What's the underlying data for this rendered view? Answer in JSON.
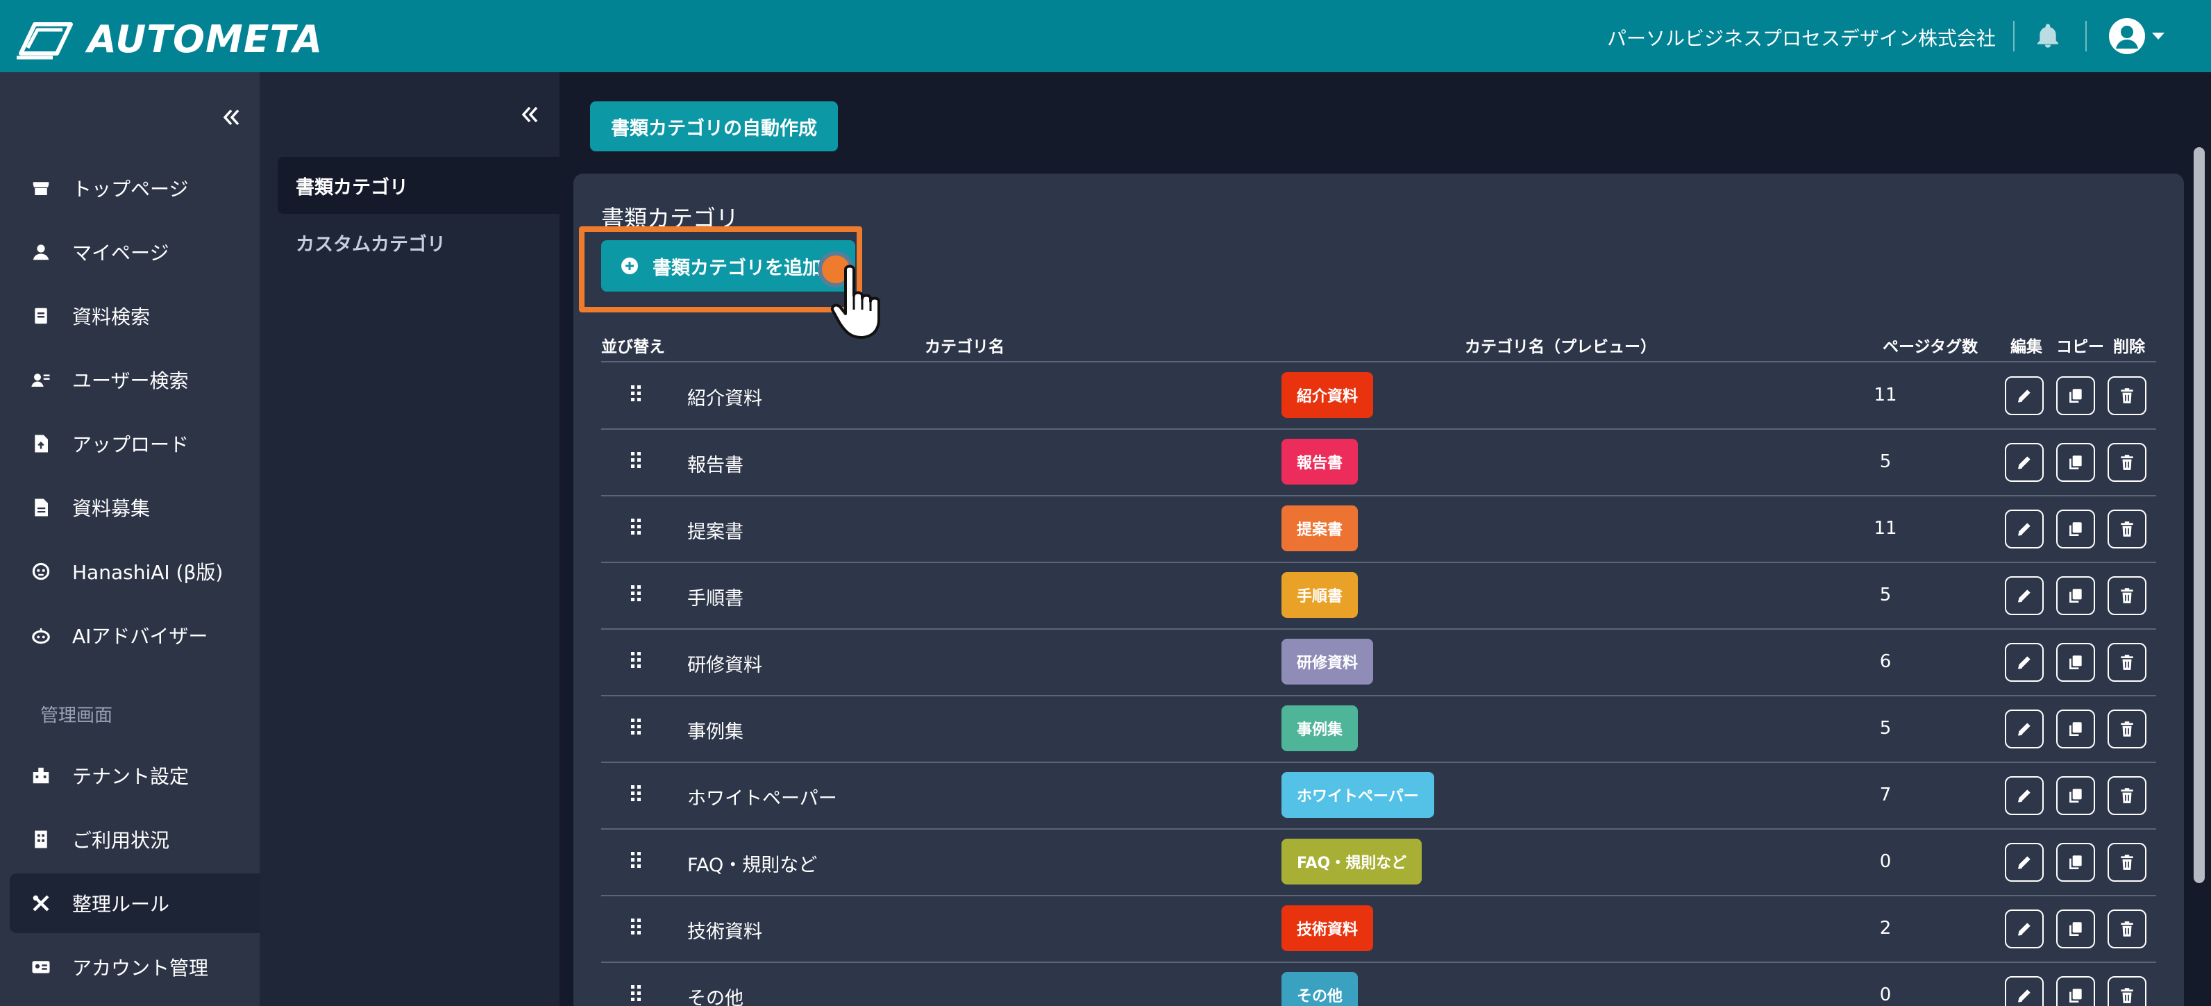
{
  "header": {
    "logo_text": "AUTOMETA",
    "company": "パーソルビジネスプロセスデザイン株式会社",
    "bg_color": "#028394"
  },
  "sidebar": {
    "items": [
      {
        "label": "トップページ",
        "icon": "store-icon"
      },
      {
        "label": "マイページ",
        "icon": "person-icon"
      },
      {
        "label": "資料検索",
        "icon": "document-search-icon"
      },
      {
        "label": "ユーザー検索",
        "icon": "user-search-icon"
      },
      {
        "label": "アップロード",
        "icon": "upload-file-icon"
      },
      {
        "label": "資料募集",
        "icon": "file-icon"
      },
      {
        "label": "HanashiAI (β版)",
        "icon": "chat-bot-icon"
      },
      {
        "label": "AIアドバイザー",
        "icon": "robot-icon"
      }
    ],
    "section_label": "管理画面",
    "admin_items": [
      {
        "label": "テナント設定",
        "icon": "building-settings-icon"
      },
      {
        "label": "ご利用状況",
        "icon": "office-building-icon"
      },
      {
        "label": "整理ルール",
        "icon": "tools-icon",
        "active": true
      },
      {
        "label": "アカウント管理",
        "icon": "id-card-icon"
      }
    ]
  },
  "subnav": {
    "items": [
      {
        "label": "書類カテゴリ",
        "active": true
      },
      {
        "label": "カスタムカテゴリ",
        "active": false
      }
    ]
  },
  "main": {
    "auto_create_label": "書類カテゴリの自動作成",
    "panel_title": "書類カテゴリ",
    "add_button_label": "書類カテゴリを追加",
    "table": {
      "headers": {
        "sort": "並び替え",
        "name": "カテゴリ名",
        "preview": "カテゴリ名（プレビュー）",
        "count": "ページタグ数",
        "edit": "編集",
        "copy": "コピー",
        "delete": "削除"
      },
      "rows": [
        {
          "name": "紹介資料",
          "badge": "紹介資料",
          "color": "#e8330e",
          "count": "11"
        },
        {
          "name": "報告書",
          "badge": "報告書",
          "color": "#ec2c5a",
          "count": "5"
        },
        {
          "name": "提案書",
          "badge": "提案書",
          "color": "#ec7332",
          "count": "11"
        },
        {
          "name": "手順書",
          "badge": "手順書",
          "color": "#e9a127",
          "count": "5"
        },
        {
          "name": "研修資料",
          "badge": "研修資料",
          "color": "#8f8db8",
          "count": "6"
        },
        {
          "name": "事例集",
          "badge": "事例集",
          "color": "#4fb598",
          "count": "5"
        },
        {
          "name": "ホワイトペーパー",
          "badge": "ホワイトペーパー",
          "color": "#54c1e6",
          "count": "7"
        },
        {
          "name": "FAQ・規則など",
          "badge": "FAQ・規則など",
          "color": "#a7b034",
          "count": "0"
        },
        {
          "name": "技術資料",
          "badge": "技術資料",
          "color": "#e8330e",
          "count": "2"
        },
        {
          "name": "その他",
          "badge": "その他",
          "color": "#3aa1c0",
          "count": "0"
        }
      ]
    }
  }
}
